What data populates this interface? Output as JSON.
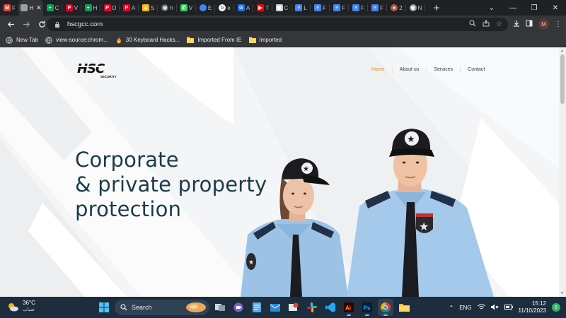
{
  "browser": {
    "tabs": [
      {
        "label": "F",
        "icon": "gmail-icon",
        "color": "#ea4335",
        "glyph": "M"
      },
      {
        "label": "H",
        "icon": "page-icon",
        "color": "#9aa0a6",
        "glyph": "",
        "active": true
      },
      {
        "label": "C",
        "icon": "sheets-icon",
        "color": "#0f9d58",
        "glyph": "+"
      },
      {
        "label": "V",
        "icon": "pinterest-icon",
        "color": "#e60023",
        "glyph": "P"
      },
      {
        "label": "H",
        "icon": "sheets-icon",
        "color": "#0f9d58",
        "glyph": "+"
      },
      {
        "label": "D",
        "icon": "pinterest-icon",
        "color": "#e60023",
        "glyph": "P"
      },
      {
        "label": "A",
        "icon": "pinterest-icon",
        "color": "#e60023",
        "glyph": "P"
      },
      {
        "label": "S",
        "icon": "drive-icon",
        "color": "#fbbc04",
        "glyph": "▲"
      },
      {
        "label": "h",
        "icon": "globe-icon",
        "color": "#5f6368",
        "glyph": "◍"
      },
      {
        "label": "V",
        "icon": "whatsapp-icon",
        "color": "#25d366",
        "glyph": "✆"
      },
      {
        "label": "E",
        "icon": "blue-dot-icon",
        "color": "#4285f4",
        "glyph": ""
      },
      {
        "label": "e",
        "icon": "google-icon",
        "color": "#ffffff",
        "glyph": "G"
      },
      {
        "label": "A",
        "icon": "google-blue-icon",
        "color": "#1a73e8",
        "glyph": "G"
      },
      {
        "label": "T",
        "icon": "youtube-icon",
        "color": "#ff0000",
        "glyph": "▶"
      },
      {
        "label": "C",
        "icon": "image-icon",
        "color": "#c9d0d8",
        "glyph": "▣"
      },
      {
        "label": "L",
        "icon": "docs-icon",
        "color": "#4285f4",
        "glyph": "≡"
      },
      {
        "label": "F",
        "icon": "docs-icon",
        "color": "#4285f4",
        "glyph": "≡"
      },
      {
        "label": "F",
        "icon": "docs-icon",
        "color": "#4285f4",
        "glyph": "≡"
      },
      {
        "label": "F",
        "icon": "docs-icon",
        "color": "#4285f4",
        "glyph": "≡"
      },
      {
        "label": "F",
        "icon": "docs-icon",
        "color": "#4285f4",
        "glyph": "≡"
      },
      {
        "label": "2",
        "icon": "avatar-icon",
        "color": "#b65a4e",
        "glyph": "●"
      },
      {
        "label": "N",
        "icon": "chrome-icon",
        "color": "#9aa0a6",
        "glyph": "◉"
      }
    ],
    "new_tab": "+",
    "url": "hscgcc.com",
    "profile_initial": "M",
    "bookmarks": [
      {
        "label": "New Tab",
        "icon": "globe-icon"
      },
      {
        "label": "view-source:chrom...",
        "icon": "globe-icon"
      },
      {
        "label": "30 Keyboard Hacks...",
        "icon": "flame-icon"
      },
      {
        "label": "Imported From IE",
        "icon": "folder-icon"
      },
      {
        "label": "Imported",
        "icon": "folder-icon"
      }
    ]
  },
  "site": {
    "logo_text": "HSC",
    "logo_sub": "SECURITY",
    "nav": [
      {
        "label": "Home",
        "active": true
      },
      {
        "label": "About us",
        "active": false
      },
      {
        "label": "Services",
        "active": false
      },
      {
        "label": "Contact",
        "active": false
      }
    ],
    "hero_title": "Corporate\n& private property\nprotection"
  },
  "taskbar": {
    "temperature": "36°C",
    "weather_desc": "ضباب",
    "search_placeholder": "Search",
    "language": "ENG",
    "time": "15:12",
    "date": "11/10/2023",
    "notifications": "5",
    "apps": [
      {
        "name": "start-icon",
        "running": false
      },
      {
        "name": "search-box",
        "running": false
      },
      {
        "name": "task-view-icon",
        "running": false
      },
      {
        "name": "meet-icon",
        "running": false
      },
      {
        "name": "notepad-icon",
        "running": false
      },
      {
        "name": "mail-icon",
        "running": false
      },
      {
        "name": "snipping-icon",
        "running": false
      },
      {
        "name": "slack-icon",
        "running": false
      },
      {
        "name": "vscode-icon",
        "running": false
      },
      {
        "name": "illustrator-icon",
        "running": true
      },
      {
        "name": "photoshop-icon",
        "running": true
      },
      {
        "name": "chrome-icon",
        "running": true
      },
      {
        "name": "file-explorer-icon",
        "running": false
      }
    ]
  }
}
